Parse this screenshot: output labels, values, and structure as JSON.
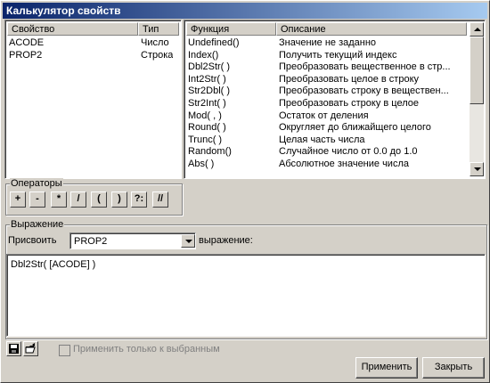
{
  "window": {
    "title": "Калькулятор свойств"
  },
  "properties": {
    "columns": [
      "Свойство",
      "Тип"
    ],
    "rows": [
      {
        "name": "ACODE",
        "type": "Число"
      },
      {
        "name": "PROP2",
        "type": "Строка"
      }
    ]
  },
  "functions": {
    "columns": [
      "Функция",
      "Описание"
    ],
    "rows": [
      {
        "name": "Undefined()",
        "desc": "Значение не заданно"
      },
      {
        "name": "Index()",
        "desc": "Получить текущий индекс"
      },
      {
        "name": "Dbl2Str( )",
        "desc": "Преобразовать вещественное в стр..."
      },
      {
        "name": "Int2Str( )",
        "desc": "Преобразовать целое в строку"
      },
      {
        "name": "Str2Dbl( )",
        "desc": "Преобразовать строку в веществен..."
      },
      {
        "name": "Str2Int( )",
        "desc": "Преобразовать строку в целое"
      },
      {
        "name": "Mod( , )",
        "desc": "Остаток от деления"
      },
      {
        "name": "Round( )",
        "desc": "Округляет до ближайщего целого"
      },
      {
        "name": "Trunc( )",
        "desc": "Целая часть числа"
      },
      {
        "name": "Random()",
        "desc": "Случайное число от 0.0 до 1.0"
      },
      {
        "name": "Abs( )",
        "desc": "Абсолютное значение числа"
      }
    ]
  },
  "operators": {
    "label": "Операторы",
    "buttons": [
      "+",
      "-",
      "*",
      "/",
      "(",
      ")",
      "?:",
      "//"
    ]
  },
  "expression": {
    "label": "Выражение",
    "assign_label": "Присвоить",
    "assign_value": "PROP2",
    "expr_label": "выражение:",
    "text": "Dbl2Str( [ACODE] )"
  },
  "footer": {
    "apply_selected_label": "Применить только к выбранным",
    "apply_button": "Применить",
    "close_button": "Закрыть"
  },
  "icons": {
    "save": "floppy-disk-icon",
    "open": "open-folder-icon"
  }
}
